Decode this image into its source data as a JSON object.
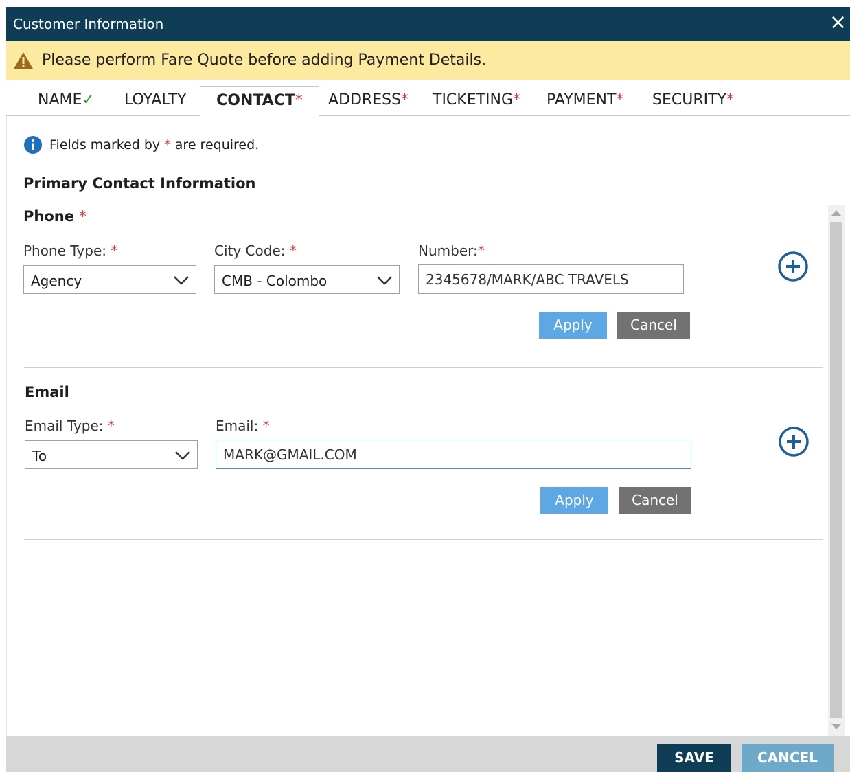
{
  "window": {
    "title": "Customer Information",
    "close_glyph": "×"
  },
  "warning": {
    "text": "Please perform Fare Quote before adding Payment Details.",
    "icon": "warning-triangle-icon",
    "color": "#fdeaa1"
  },
  "tabs": [
    {
      "label": "NAME",
      "suffix": "✓",
      "suffix_type": "check"
    },
    {
      "label": "LOYALTY",
      "suffix": "",
      "suffix_type": "none"
    },
    {
      "label": "CONTACT",
      "suffix": "*",
      "suffix_type": "required",
      "active": true
    },
    {
      "label": "ADDRESS",
      "suffix": "*",
      "suffix_type": "required"
    },
    {
      "label": "TICKETING",
      "suffix": "*",
      "suffix_type": "required"
    },
    {
      "label": "PAYMENT",
      "suffix": "*",
      "suffix_type": "required"
    },
    {
      "label": "SECURITY",
      "suffix": "*",
      "suffix_type": "required"
    }
  ],
  "info": {
    "text_before": "Fields marked by",
    "asterisk": "*",
    "text_after": "are required."
  },
  "primary_heading": "Primary Contact Information",
  "phone": {
    "heading": "Phone",
    "required": "*",
    "type_label": "Phone Type:",
    "type_value": "Agency",
    "city_label": "City Code:",
    "city_value": "CMB - Colombo",
    "number_label": "Number:",
    "number_value": "2345678/MARK/ABC TRAVELS",
    "apply_label": "Apply",
    "cancel_label": "Cancel"
  },
  "email": {
    "heading": "Email",
    "type_label": "Email Type:",
    "type_value": "To",
    "email_label": "Email:",
    "email_value": "MARK@GMAIL.COM",
    "apply_label": "Apply",
    "cancel_label": "Cancel"
  },
  "footer": {
    "save_label": "SAVE",
    "cancel_label": "CANCEL"
  },
  "colors": {
    "title_bar": "#0f3d56",
    "apply": "#5da8e4",
    "cancel": "#727272",
    "required": "#d63a3a",
    "check": "#2e9a3a",
    "footer_cancel": "#6fa9ca",
    "plus_icon": "#1f5f9a"
  }
}
